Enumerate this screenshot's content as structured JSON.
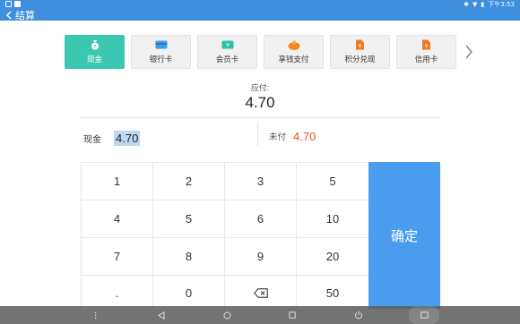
{
  "statusbar": {
    "time": "下午3:53"
  },
  "header": {
    "title": "结算"
  },
  "payment_methods": [
    {
      "label": "现金",
      "icon": "cash-bag-icon",
      "active": true
    },
    {
      "label": "银行卡",
      "icon": "bank-card-icon",
      "active": false
    },
    {
      "label": "会员卡",
      "icon": "member-card-icon",
      "active": false
    },
    {
      "label": "享钱支付",
      "icon": "wallet-icon",
      "active": false
    },
    {
      "label": "积分兑现",
      "icon": "points-doc-icon",
      "active": false
    },
    {
      "label": "信用卡",
      "icon": "credit-doc-icon",
      "active": false
    }
  ],
  "due": {
    "label": "应付:",
    "amount": "4.70"
  },
  "cash": {
    "label": "现金",
    "value": "4.70"
  },
  "unpaid": {
    "label": "未付",
    "value": "4.70"
  },
  "keypad": {
    "rows": [
      [
        "1",
        "2",
        "3",
        "5"
      ],
      [
        "4",
        "5",
        "6",
        "10"
      ],
      [
        "7",
        "8",
        "9",
        "20"
      ],
      [
        ".",
        "0",
        "⌫",
        "50"
      ]
    ]
  },
  "confirm": {
    "label": "确定"
  },
  "colors": {
    "bar_blue": "#3f8fdf",
    "active_teal": "#3cc8b0",
    "confirm_blue": "#4a9cef",
    "unpaid_orange": "#e8501e"
  }
}
